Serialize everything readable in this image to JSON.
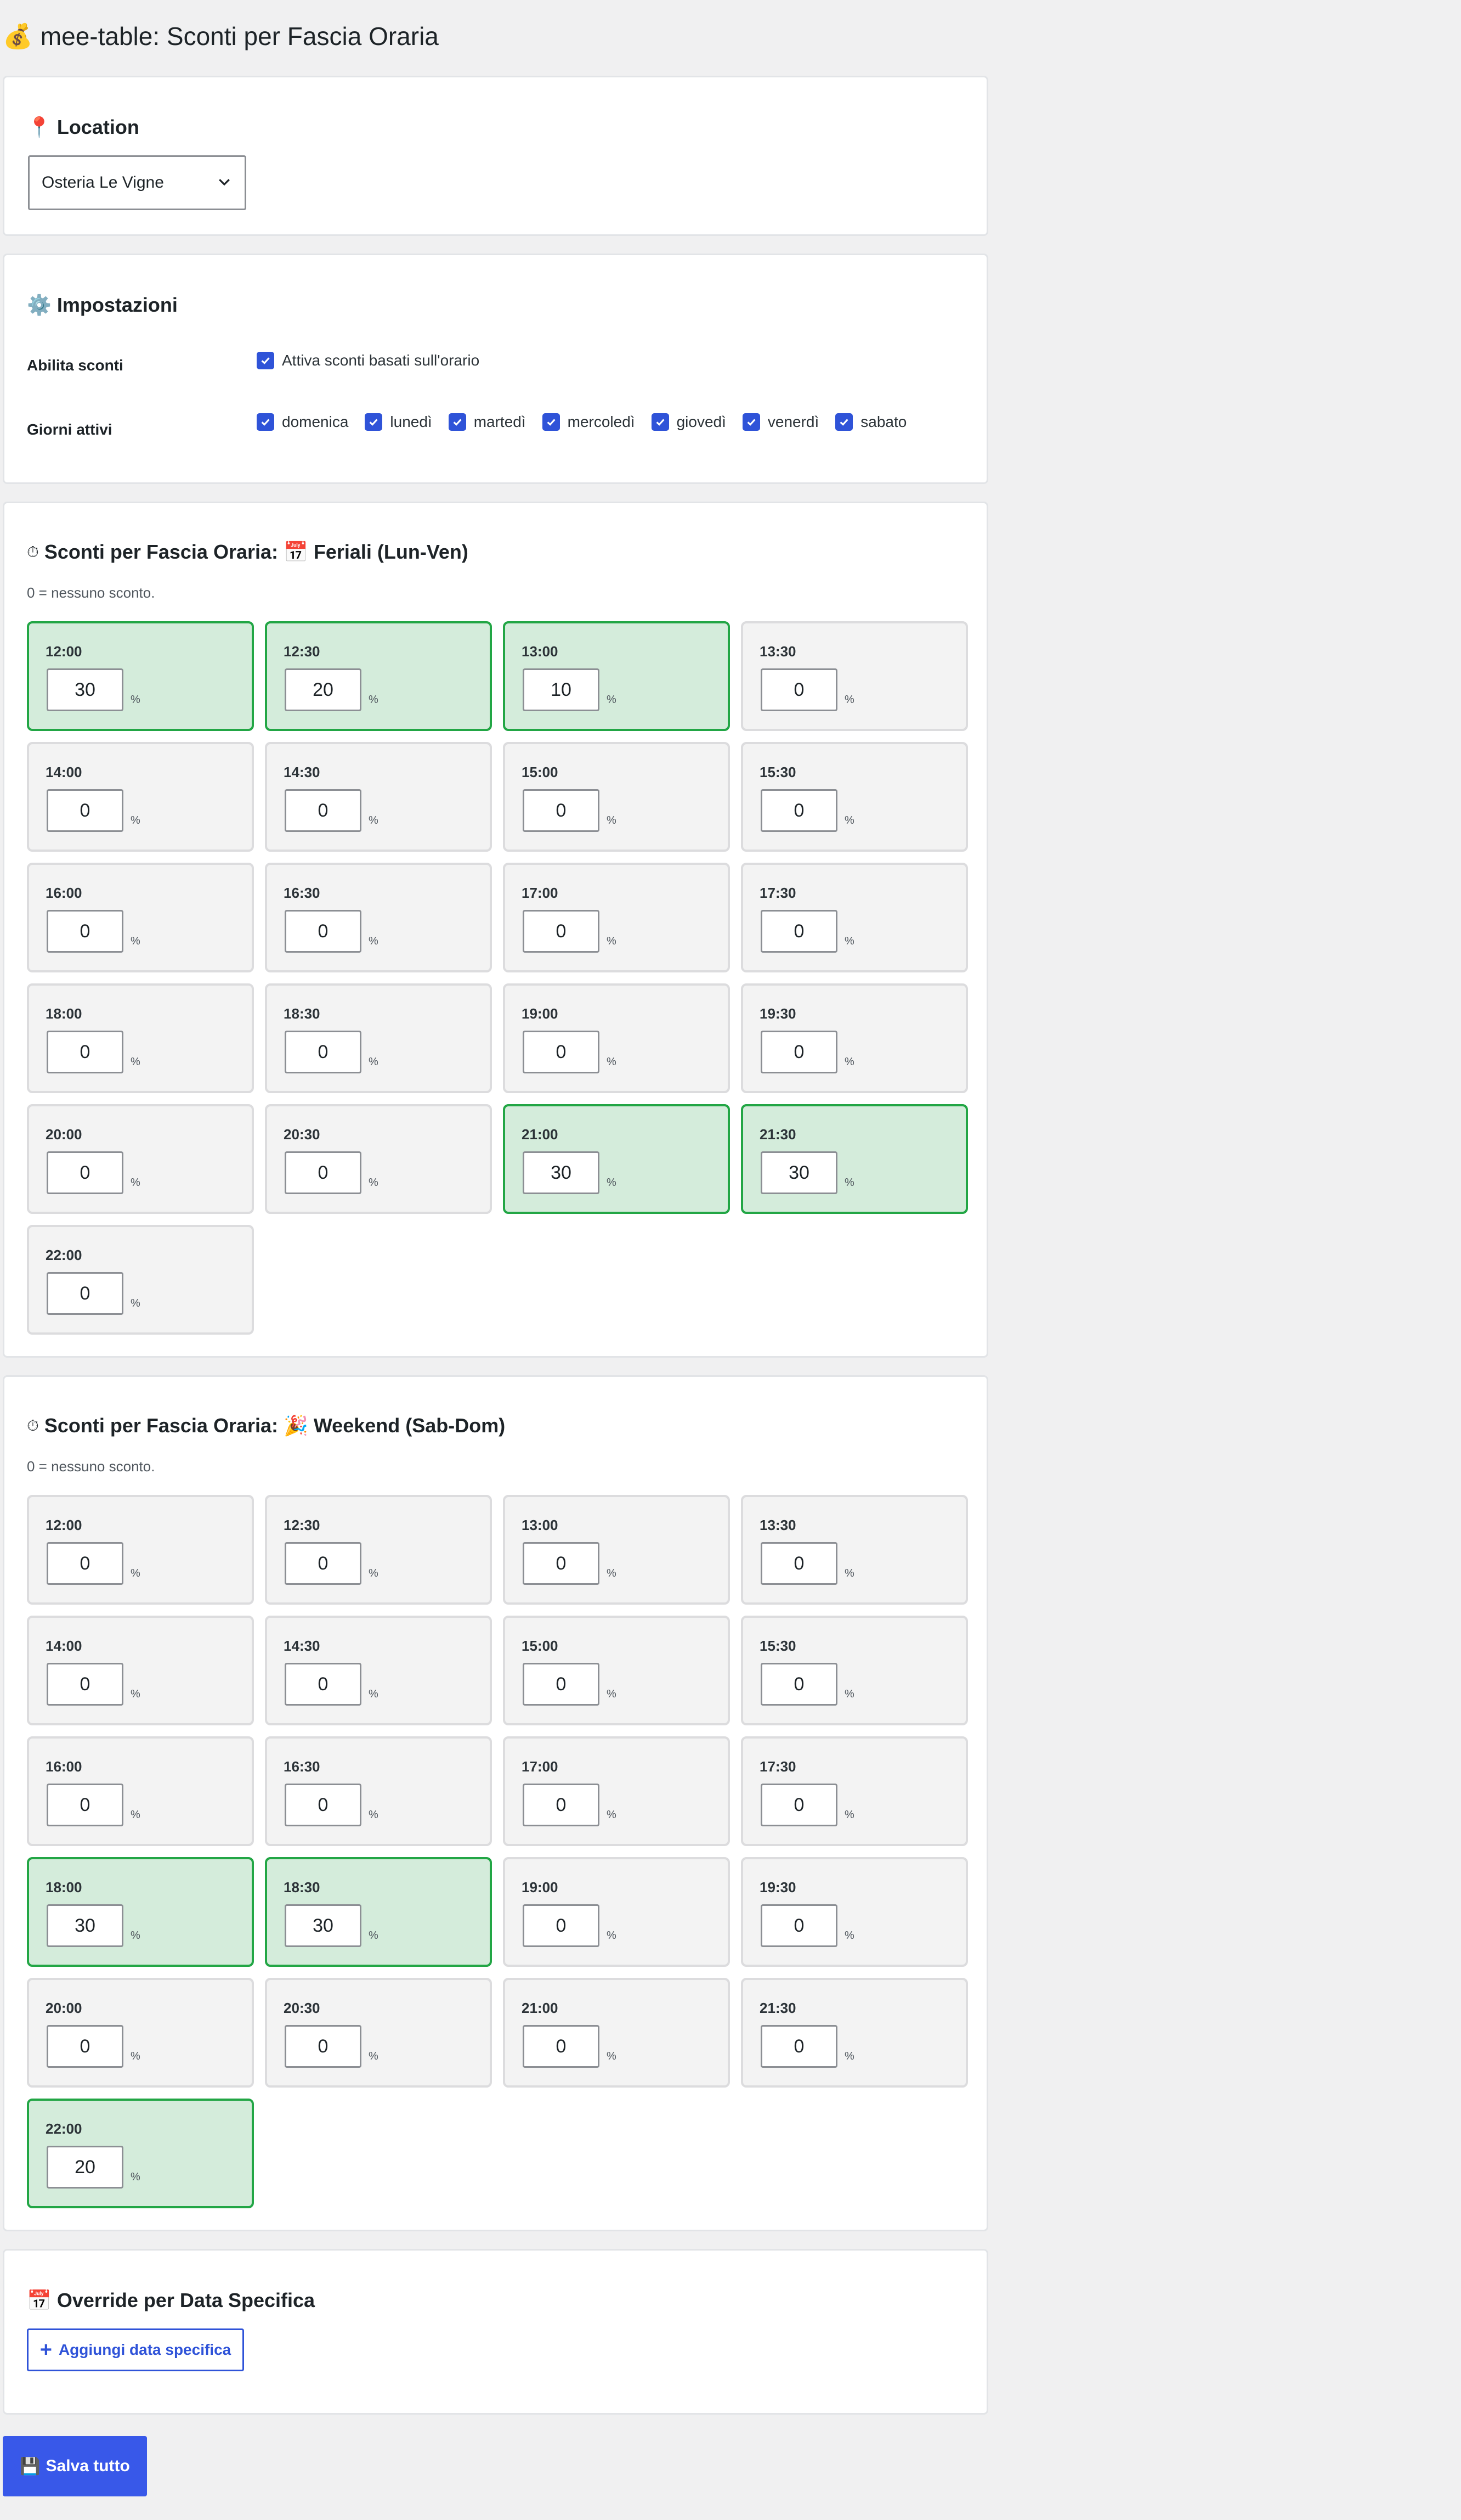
{
  "page": {
    "title": "mee-table: Sconti per Fascia Oraria",
    "title_icon": "💰"
  },
  "location": {
    "heading": "Location",
    "icon": "📍",
    "selected": "Osteria Le Vigne"
  },
  "settings": {
    "heading": "Impostazioni",
    "icon": "⚙️",
    "enable_label": "Abilita sconti",
    "enable_text": "Attiva sconti basati sull'orario",
    "enable_checked": true,
    "days_label": "Giorni attivi",
    "days": [
      {
        "label": "domenica",
        "checked": true
      },
      {
        "label": "lunedì",
        "checked": true
      },
      {
        "label": "martedì",
        "checked": true
      },
      {
        "label": "mercoledì",
        "checked": true
      },
      {
        "label": "giovedì",
        "checked": true
      },
      {
        "label": "venerdì",
        "checked": true
      },
      {
        "label": "sabato",
        "checked": true
      }
    ]
  },
  "weekday": {
    "heading_prefix": "Sconti per Fascia Oraria:",
    "heading_icon": "⏱",
    "heading_emoji": "📅",
    "heading_suffix": "Feriali (Lun-Ven)",
    "hint": "0 = nessuno sconto.",
    "percent_symbol": "%",
    "slots": [
      {
        "time": "12:00",
        "value": "30"
      },
      {
        "time": "12:30",
        "value": "20"
      },
      {
        "time": "13:00",
        "value": "10"
      },
      {
        "time": "13:30",
        "value": "0"
      },
      {
        "time": "14:00",
        "value": "0"
      },
      {
        "time": "14:30",
        "value": "0"
      },
      {
        "time": "15:00",
        "value": "0"
      },
      {
        "time": "15:30",
        "value": "0"
      },
      {
        "time": "16:00",
        "value": "0"
      },
      {
        "time": "16:30",
        "value": "0"
      },
      {
        "time": "17:00",
        "value": "0"
      },
      {
        "time": "17:30",
        "value": "0"
      },
      {
        "time": "18:00",
        "value": "0"
      },
      {
        "time": "18:30",
        "value": "0"
      },
      {
        "time": "19:00",
        "value": "0"
      },
      {
        "time": "19:30",
        "value": "0"
      },
      {
        "time": "20:00",
        "value": "0"
      },
      {
        "time": "20:30",
        "value": "0"
      },
      {
        "time": "21:00",
        "value": "30"
      },
      {
        "time": "21:30",
        "value": "30"
      },
      {
        "time": "22:00",
        "value": "0"
      }
    ]
  },
  "weekend": {
    "heading_prefix": "Sconti per Fascia Oraria:",
    "heading_icon": "⏱",
    "heading_emoji": "🎉",
    "heading_suffix": "Weekend (Sab-Dom)",
    "hint": "0 = nessuno sconto.",
    "percent_symbol": "%",
    "slots": [
      {
        "time": "12:00",
        "value": "0"
      },
      {
        "time": "12:30",
        "value": "0"
      },
      {
        "time": "13:00",
        "value": "0"
      },
      {
        "time": "13:30",
        "value": "0"
      },
      {
        "time": "14:00",
        "value": "0"
      },
      {
        "time": "14:30",
        "value": "0"
      },
      {
        "time": "15:00",
        "value": "0"
      },
      {
        "time": "15:30",
        "value": "0"
      },
      {
        "time": "16:00",
        "value": "0"
      },
      {
        "time": "16:30",
        "value": "0"
      },
      {
        "time": "17:00",
        "value": "0"
      },
      {
        "time": "17:30",
        "value": "0"
      },
      {
        "time": "18:00",
        "value": "30"
      },
      {
        "time": "18:30",
        "value": "30"
      },
      {
        "time": "19:00",
        "value": "0"
      },
      {
        "time": "19:30",
        "value": "0"
      },
      {
        "time": "20:00",
        "value": "0"
      },
      {
        "time": "20:30",
        "value": "0"
      },
      {
        "time": "21:00",
        "value": "0"
      },
      {
        "time": "21:30",
        "value": "0"
      },
      {
        "time": "22:00",
        "value": "20"
      }
    ]
  },
  "override": {
    "heading": "Override per Data Specifica",
    "icon": "📅",
    "add_label": "Aggiungi data specifica",
    "add_icon": "+"
  },
  "save": {
    "label": "Salva tutto",
    "icon": "💾"
  },
  "colors": {
    "accent": "#3858e9",
    "active_slot_bg": "#d4ecdb",
    "active_slot_border": "#22a645",
    "page_bg": "#f0f0f1"
  }
}
